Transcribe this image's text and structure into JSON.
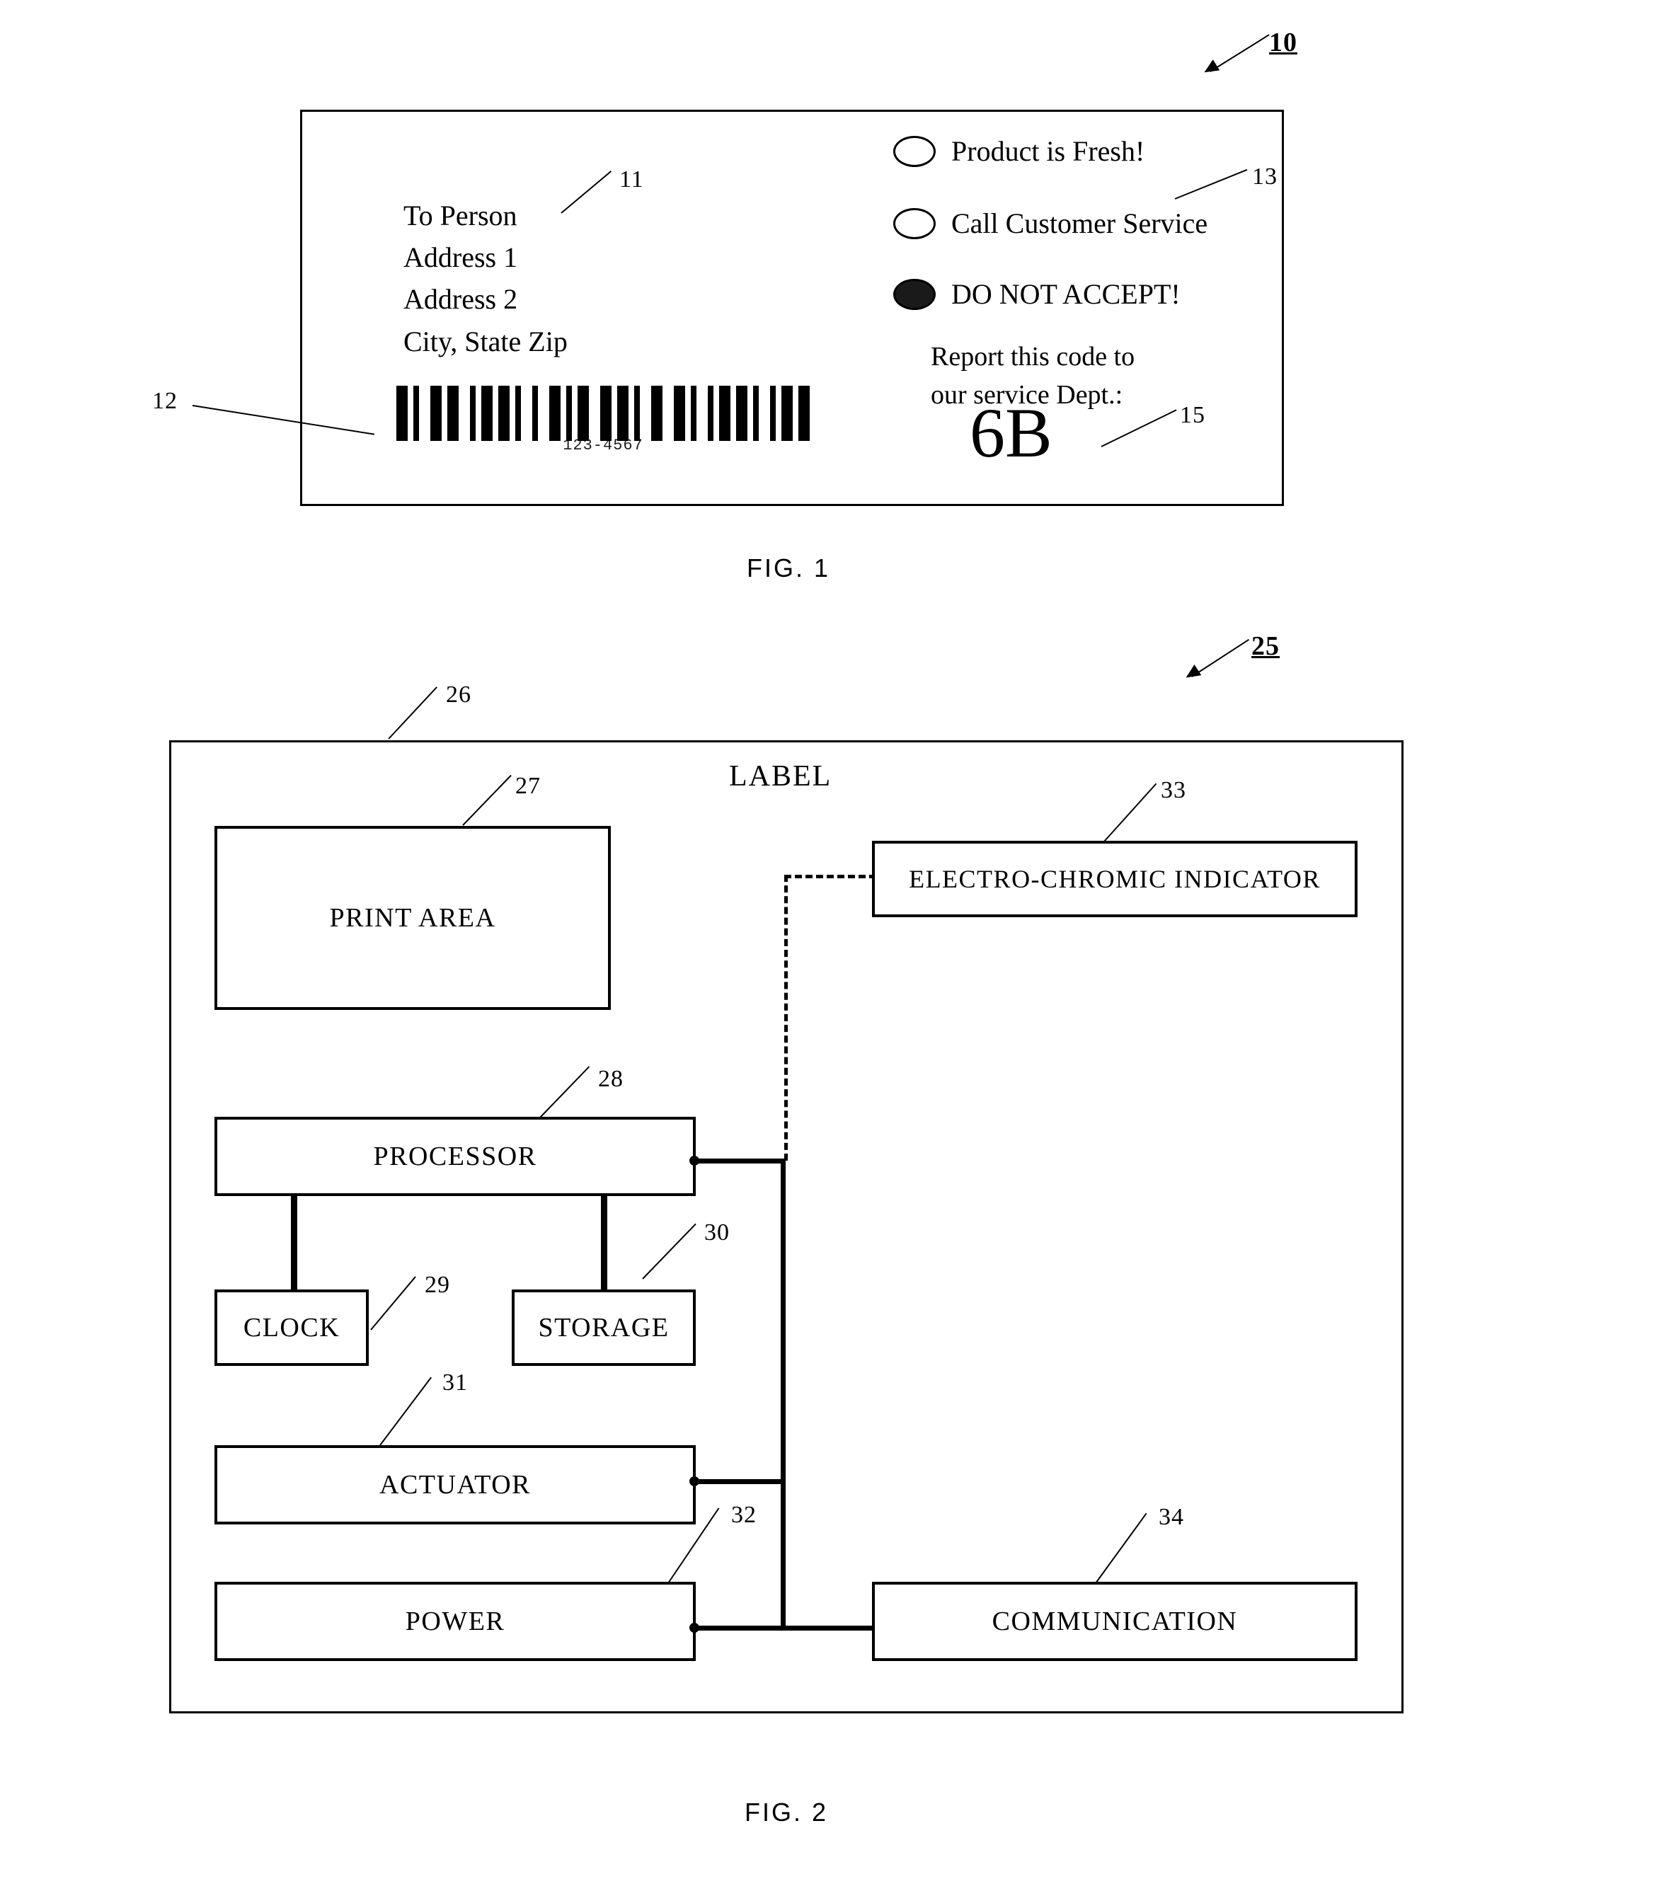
{
  "document": {
    "type": "patent-drawing-sheet",
    "figures": [
      {
        "caption": "FIG. 1"
      },
      {
        "caption": "FIG. 2"
      }
    ]
  },
  "fig1": {
    "caption": "FIG. 1",
    "assembly_ref": "10",
    "label_ref": "12",
    "address_ref": "11",
    "indicator_ref": "13",
    "code_ref": "15",
    "address": {
      "line1": "To Person",
      "line2": "Address 1",
      "line3": "Address 2",
      "line4": "City, State Zip"
    },
    "indicators": [
      {
        "state": "open",
        "label": "Product is Fresh!"
      },
      {
        "state": "open",
        "label": "Call Customer Service"
      },
      {
        "state": "filled",
        "label": "DO NOT ACCEPT!"
      }
    ],
    "report": {
      "line1": "Report this code to",
      "line2": "our service Dept.:",
      "code": "6B"
    },
    "barcode": {
      "digits": "123-4567",
      "pattern": "1101001101100101101101001001101011001101101001100110100101101101001011011"
    }
  },
  "fig2": {
    "caption": "FIG. 2",
    "system_ref": "25",
    "title": "LABEL",
    "title_ref": "26",
    "blocks": [
      {
        "ref": "27",
        "label": "PRINT AREA"
      },
      {
        "ref": "28",
        "label": "PROCESSOR"
      },
      {
        "ref": "29",
        "label": "CLOCK"
      },
      {
        "ref": "30",
        "label": "STORAGE"
      },
      {
        "ref": "31",
        "label": "ACTUATOR"
      },
      {
        "ref": "32",
        "label": "POWER"
      },
      {
        "ref": "33",
        "label": "ELECTRO-CHROMIC INDICATOR"
      },
      {
        "ref": "34",
        "label": "COMMUNICATION"
      }
    ]
  },
  "colors": {
    "ink": "#000000",
    "paper": "#ffffff"
  }
}
